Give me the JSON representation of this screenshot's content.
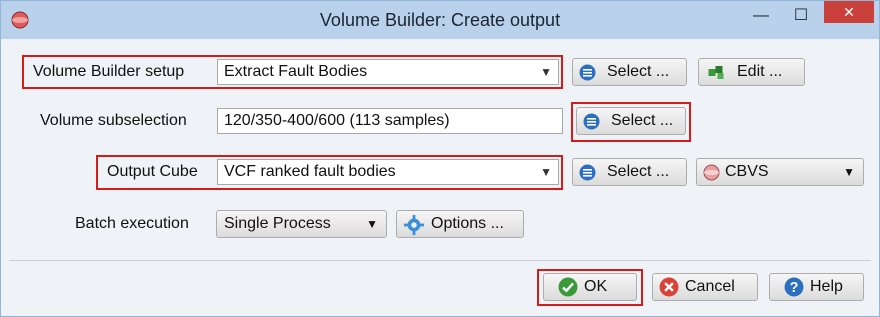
{
  "window": {
    "title": "Volume Builder: Create output",
    "minimize_glyph": "—",
    "maximize_glyph": "☐",
    "close_glyph": "✕"
  },
  "setup": {
    "label": "Volume Builder setup",
    "value": "Extract Fault Bodies",
    "select_label": "Select ...",
    "edit_label": "Edit ..."
  },
  "subselection": {
    "label": "Volume subselection",
    "value": "120/350-400/600 (113 samples)",
    "select_label": "Select ..."
  },
  "output": {
    "label": "Output Cube",
    "value": "VCF ranked fault bodies",
    "select_label": "Select ...",
    "format_value": "CBVS"
  },
  "batch": {
    "label": "Batch execution",
    "value": "Single Process",
    "options_label": "Options ..."
  },
  "footer": {
    "ok_label": "OK",
    "cancel_label": "Cancel",
    "help_label": "Help"
  },
  "icons": {
    "app": "od-app-icon",
    "select": "list-icon",
    "edit": "cubes-icon",
    "options": "gear-icon",
    "format": "cube-format-icon",
    "ok": "check-icon",
    "cancel": "cancel-x-icon",
    "help": "help-icon"
  },
  "colors": {
    "titlebar": "#b9d1ea",
    "highlight": "#d61b1b",
    "close": "#c9413a",
    "select_icon": "#2c6fbf",
    "ok_icon": "#3a9a3a",
    "cancel_icon": "#d9433a"
  }
}
